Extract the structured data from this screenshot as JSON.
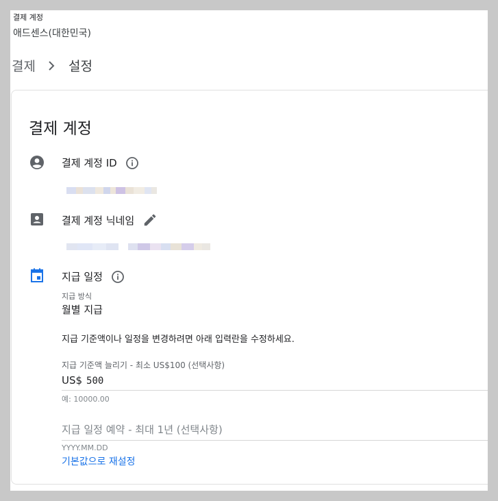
{
  "account": {
    "title": "결제 계정",
    "subtitle": "애드센스(대한민국)"
  },
  "breadcrumb": {
    "parent": "결제",
    "current": "설정"
  },
  "card": {
    "title": "결제 계정",
    "account_id": {
      "label": "결제 계정 ID",
      "icon": "account-circle-icon"
    },
    "nickname": {
      "label": "결제 계정 닉네임",
      "icon": "contact-card-icon"
    },
    "schedule": {
      "label": "지급 일정",
      "icon": "calendar-icon",
      "method_label": "지급 방식",
      "method_value": "월별 지급",
      "description": "지급 기준액이나 일정을 변경하려면 아래 입력란을 수정하세요.",
      "threshold": {
        "label": "지급 기준액 늘리기 - 최소 US$100 (선택사항)",
        "currency": "US$",
        "value": "500",
        "hint": "예: 10000.00"
      },
      "hold": {
        "placeholder": "지급 일정 예약 - 최대 1년 (선택사항)",
        "hint": "YYYY.MM.DD"
      },
      "reset_link": "기본값으로 재설정"
    }
  },
  "colors": {
    "accent": "#1a73e8",
    "icon_grey": "#5f6368",
    "text": "#202124"
  }
}
